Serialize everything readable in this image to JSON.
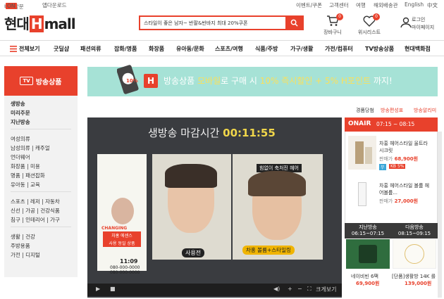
{
  "util": {
    "left1": "바로방문",
    "on": "ON",
    "left2": "앱다운로드",
    "right": [
      "이벤트/쿠폰",
      "고객센터",
      "여행",
      "해외배송관",
      "English",
      "中文"
    ]
  },
  "logo": {
    "pre": "현대",
    "h": "H",
    "post": "mall"
  },
  "search": {
    "value": "스타일이 좋은 남자~ 반팔&반바지 최대 20%쿠폰"
  },
  "header_icons": {
    "cart": "장바구니",
    "cart_count": "0",
    "wish": "위시리스트",
    "wish_count": "0",
    "login": "로그인",
    "mypage": "마이페이지"
  },
  "gnb": [
    "전체보기",
    "굿딜샵",
    "패션의류",
    "잡화/명품",
    "화장품",
    "유아동/문화",
    "스포츠/여행",
    "식품/주방",
    "가구/생활",
    "가전/컴퓨터",
    "TV방송상품",
    "현대백화점"
  ],
  "lnav": {
    "badge": "TV",
    "title": "방송상품",
    "group1": [
      "생방송",
      "미리주문",
      "지난방송"
    ],
    "group2": [
      "여성의류",
      "남성의류 | 캐주얼",
      "언더웨어",
      "화장품 | 미용",
      "명품 | 패션잡화",
      "유아동 | 교육"
    ],
    "group3": [
      "스포츠 | 레저 | 자동차",
      "신선 | 가공 | 건강식품",
      "침구 | 인테리어 | 가구"
    ],
    "group4": [
      "생활 | 건강",
      "주방용품",
      "가전 | 디지털"
    ]
  },
  "banner": {
    "badge": "10%",
    "h": "H",
    "t1": "방송상품 ",
    "t2": "모바일",
    "t3": "로 구매 시 ",
    "t4": "10% 즉시할인 + 5% H포인트",
    "t5": " 까지!"
  },
  "tabs": [
    "경품당첨",
    "방송편성표",
    "방송알리미"
  ],
  "video": {
    "title_pre": "생방송 마감시간 ",
    "timer": "00:11:55",
    "brand": "CHANGING",
    "left_caption": "사용전",
    "right_caption": "차홍 볼륨+스타일링",
    "right_top": "힘없이 축처진 헤어",
    "promo1": "차홍 에센스",
    "promo2": "사용 동일 상품",
    "time": "11:09",
    "tel1": "080-000-0000",
    "tel2": "080-000-0000",
    "label": "크게보기"
  },
  "onair": {
    "title": "ONAIR",
    "time": "07:15 ~ 08:15",
    "items": [
      {
        "name": "차홍 헤어스타일 울트라 시크릿",
        "price": "68,900원",
        "price_label": "판매가",
        "tags": [
          "무",
          "KB 5%"
        ]
      },
      {
        "name": "차홍 헤어스타일 볼륨 헤어볼륨...",
        "price": "27,000원",
        "price_label": "판매가"
      }
    ]
  },
  "schedule": {
    "prev_title": "지난방송",
    "prev_time": "06:15~07:15",
    "prev_name": "네이비빈 6팩",
    "prev_price": "69,900원",
    "next_title": "다음방송",
    "next_time": "08:15~09:15",
    "next_name": "[단품]생활방 14K 를 ...",
    "next_price": "139,000원"
  }
}
